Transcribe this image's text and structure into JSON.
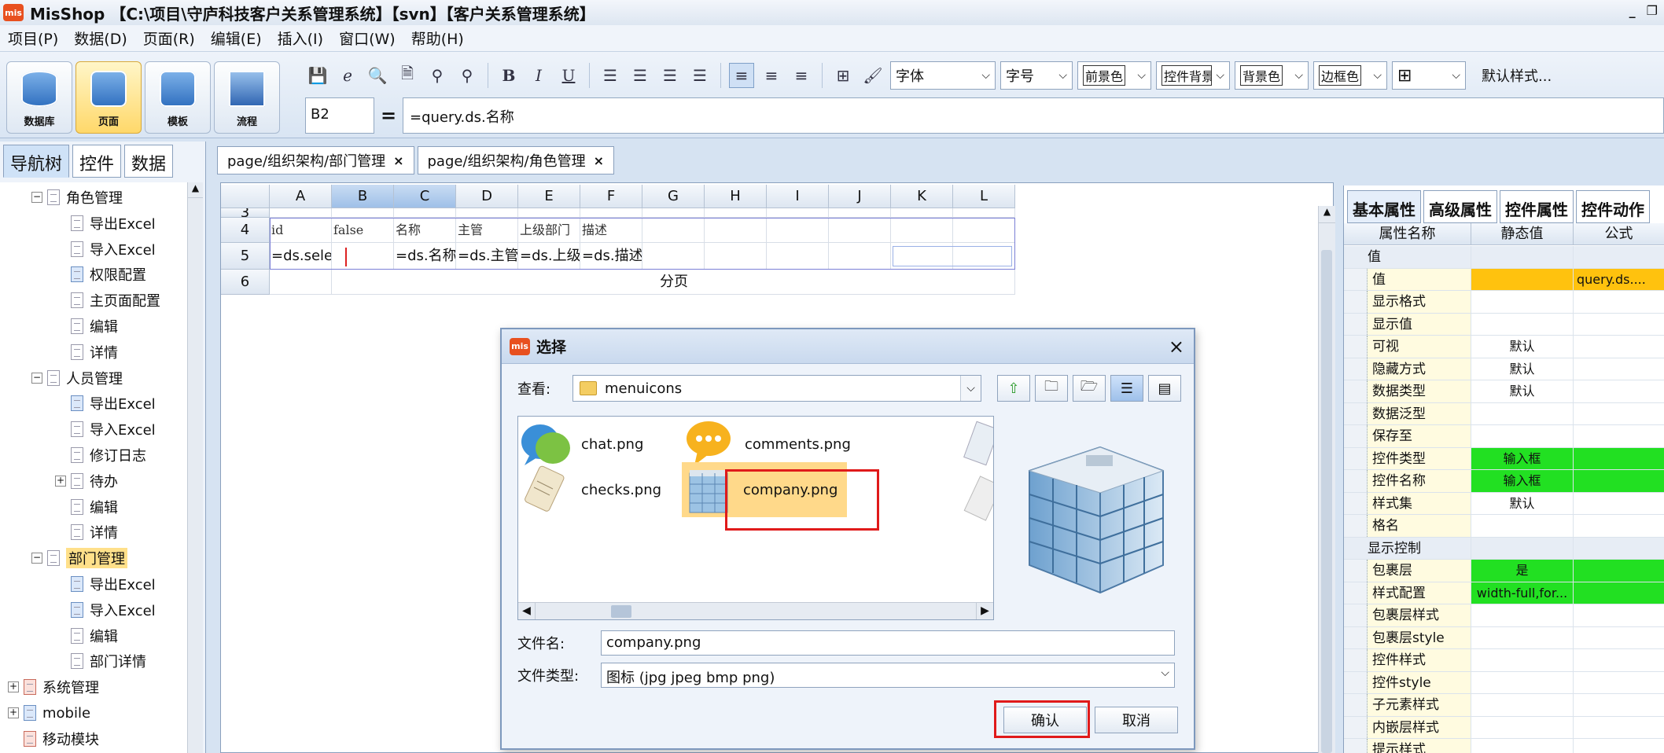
{
  "window": {
    "title": "MisShop 【C:\\项目\\守庐科技客户关系管理系统】【svn】【客户关系管理系统】",
    "logo": "mis",
    "minimize": "_",
    "restore": "❐"
  },
  "menu": [
    "项目(P)",
    "数据(D)",
    "页面(R)",
    "编辑(E)",
    "插入(I)",
    "窗口(W)",
    "帮助(H)"
  ],
  "big_buttons": [
    {
      "label": "数据库",
      "active": false
    },
    {
      "label": "页面",
      "active": true
    },
    {
      "label": "模板",
      "active": false
    },
    {
      "label": "流程",
      "active": false
    }
  ],
  "toolbar": {
    "font_select": "字体",
    "size_select": "字号",
    "fg_select": "前景色",
    "ctrl_bg_select": "控件背景",
    "bg_select": "背景色",
    "border_select": "边框色",
    "default_style": "默认样式..."
  },
  "formula": {
    "cell": "B2",
    "eq": "=",
    "value": "=query.ds.名称"
  },
  "left_tabs": [
    "导航树",
    "控件",
    "数据"
  ],
  "tree": [
    {
      "label": "角色管理",
      "level": 1,
      "exp": "−",
      "icon": "doc"
    },
    {
      "label": "导出Excel",
      "level": 2,
      "icon": "doc"
    },
    {
      "label": "导入Excel",
      "level": 2,
      "icon": "doc"
    },
    {
      "label": "权限配置",
      "level": 2,
      "icon": "blue"
    },
    {
      "label": "主页面配置",
      "level": 2,
      "icon": "doc"
    },
    {
      "label": "编辑",
      "level": 2,
      "icon": "doc"
    },
    {
      "label": "详情",
      "level": 2,
      "icon": "doc"
    },
    {
      "label": "人员管理",
      "level": 1,
      "exp": "−",
      "icon": "doc"
    },
    {
      "label": "导出Excel",
      "level": 2,
      "icon": "blue"
    },
    {
      "label": "导入Excel",
      "level": 2,
      "icon": "doc"
    },
    {
      "label": "修订日志",
      "level": 2,
      "icon": "doc"
    },
    {
      "label": "待办",
      "level": 2,
      "exp": "+",
      "icon": "doc"
    },
    {
      "label": "编辑",
      "level": 2,
      "icon": "doc"
    },
    {
      "label": "详情",
      "level": 2,
      "icon": "doc"
    },
    {
      "label": "部门管理",
      "level": 1,
      "exp": "−",
      "icon": "doc",
      "hl": true
    },
    {
      "label": "导出Excel",
      "level": 2,
      "icon": "blue"
    },
    {
      "label": "导入Excel",
      "level": 2,
      "icon": "blue"
    },
    {
      "label": "编辑",
      "level": 2,
      "icon": "doc"
    },
    {
      "label": "部门详情",
      "level": 2,
      "icon": "doc"
    },
    {
      "label": "系统管理",
      "level": 0,
      "exp": "+",
      "icon": "red"
    },
    {
      "label": "mobile",
      "level": 0,
      "exp": "+",
      "icon": "blue"
    },
    {
      "label": "移动模块",
      "level": 0,
      "icon": "red"
    }
  ],
  "editor_tabs": [
    {
      "label": "page/组织架构/部门管理",
      "close": "×"
    },
    {
      "label": "page/组织架构/角色管理",
      "close": "×"
    }
  ],
  "sheet": {
    "columns": [
      "A",
      "B",
      "C",
      "D",
      "E",
      "F",
      "G",
      "H",
      "I",
      "J",
      "K",
      "L"
    ],
    "row_numbers": [
      "3",
      "4",
      "5",
      "6"
    ],
    "row4": [
      "id",
      "false",
      "名称",
      "主管",
      "上级部门",
      "描述"
    ],
    "row5": [
      "=ds.select(",
      "",
      "=ds.名称",
      "=ds.主管",
      "=ds.上级部",
      "=ds.描述"
    ],
    "row6_center": "分页"
  },
  "dialog": {
    "title": "选择",
    "close": "×",
    "lookin_label": "查看:",
    "folder": "menuicons",
    "files": [
      "chat.png",
      "comments.png",
      "checks.png",
      "company.png"
    ],
    "selected_file": "company.png",
    "filename_label": "文件名:",
    "filename_value": "company.png",
    "filetype_label": "文件类型:",
    "filetype_value": "图标 (jpg jpeg bmp png)",
    "ok": "确认",
    "cancel": "取消"
  },
  "right_tabs": [
    "基本属性",
    "高级属性",
    "控件属性",
    "控件动作"
  ],
  "prop_headers": [
    "属性名称",
    "静态值",
    "公式"
  ],
  "props": [
    {
      "name": "值",
      "group": true
    },
    {
      "name": "值",
      "value": "",
      "formula": "query.ds....",
      "bg": "#ffc20e"
    },
    {
      "name": "显示格式"
    },
    {
      "name": "显示值"
    },
    {
      "name": "可视",
      "value": "默认"
    },
    {
      "name": "隐藏方式",
      "value": "默认"
    },
    {
      "name": "数据类型",
      "value": "默认"
    },
    {
      "name": "数据泛型"
    },
    {
      "name": "保存至"
    },
    {
      "name": "控件类型",
      "value": "输入框",
      "bg": "#22e022"
    },
    {
      "name": "控件名称",
      "value": "输入框",
      "bg": "#22e022"
    },
    {
      "name": "样式集",
      "value": "默认"
    },
    {
      "name": "格名"
    },
    {
      "name": "显示控制",
      "group": true
    },
    {
      "name": "包裹层",
      "value": "是",
      "bg": "#22e022"
    },
    {
      "name": "样式配置",
      "value": "width-full,for...",
      "bg": "#22e022"
    },
    {
      "name": "包裹层样式"
    },
    {
      "name": "包裹层style"
    },
    {
      "name": "控件样式"
    },
    {
      "name": "控件style"
    },
    {
      "name": "子元素样式"
    },
    {
      "name": "内嵌层样式"
    },
    {
      "name": "提示样式"
    }
  ]
}
